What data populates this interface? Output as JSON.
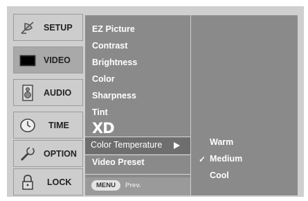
{
  "tabs": [
    {
      "label": "SETUP",
      "icon": "satellite-dish-icon",
      "active": false
    },
    {
      "label": "VIDEO",
      "icon": "tv-screen-icon",
      "active": true
    },
    {
      "label": "AUDIO",
      "icon": "speaker-icon",
      "active": false
    },
    {
      "label": "TIME",
      "icon": "clock-icon",
      "active": false
    },
    {
      "label": "OPTION",
      "icon": "wrench-icon",
      "active": false
    },
    {
      "label": "LOCK",
      "icon": "padlock-icon",
      "active": false
    }
  ],
  "menu": {
    "items": [
      "EZ Picture",
      "Contrast",
      "Brightness",
      "Color",
      "Sharpness",
      "Tint",
      "XD",
      "Color Temperature",
      "Video Preset"
    ],
    "highlighted": "Color Temperature",
    "footer": {
      "menu_button": "MENU",
      "prev": "Prev."
    }
  },
  "submenu": {
    "options": [
      "Warm",
      "Medium",
      "Cool"
    ],
    "selected": "Medium"
  },
  "colors": {
    "panel": "#8a8a8a",
    "highlight": "#6e6e6e",
    "tab": "#cdcdcd",
    "tab_active": "#a9a9a9"
  }
}
